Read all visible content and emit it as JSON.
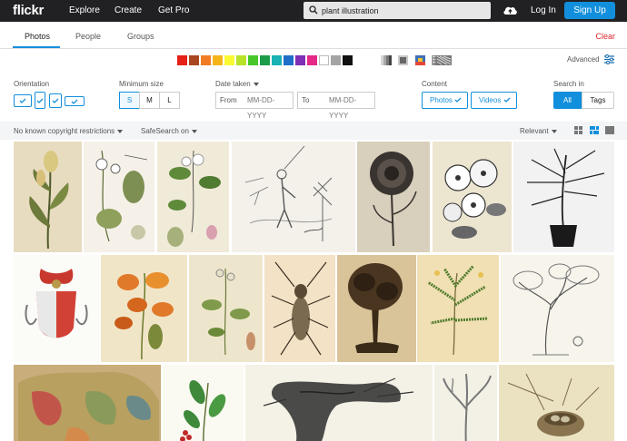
{
  "header": {
    "logo": "flickr",
    "nav": [
      "Explore",
      "Create",
      "Get Pro"
    ],
    "search_value": "plant illustration",
    "login": "Log In",
    "signup": "Sign Up"
  },
  "tabs": {
    "items": [
      "Photos",
      "People",
      "Groups"
    ],
    "active": "Photos",
    "clear": "Clear"
  },
  "colors": {
    "swatches": [
      "#e62117",
      "#a8461f",
      "#f07d24",
      "#f4b51b",
      "#fafa32",
      "#b7e227",
      "#47c72a",
      "#1c9b4a",
      "#19b2b5",
      "#1d6ec9",
      "#7e2fb6",
      "#e42987",
      "#ffffff",
      "#a4a4a4",
      "#111111"
    ],
    "advanced": "Advanced"
  },
  "filters": {
    "orientation_label": "Orientation",
    "min_size_label": "Minimum size",
    "sizes": [
      "S",
      "M",
      "L"
    ],
    "selected_size": "S",
    "date_label": "Date taken",
    "from_label": "From",
    "to_label": "To",
    "date_placeholder": "MM-DD-YYYY",
    "content_label": "Content",
    "content_photos": "Photos",
    "content_videos": "Videos",
    "search_in_label": "Search in",
    "search_all": "All",
    "search_tags": "Tags"
  },
  "subbar": {
    "license": "No known copyright restrictions",
    "safesearch": "SafeSearch on",
    "sort": "Relevant"
  }
}
